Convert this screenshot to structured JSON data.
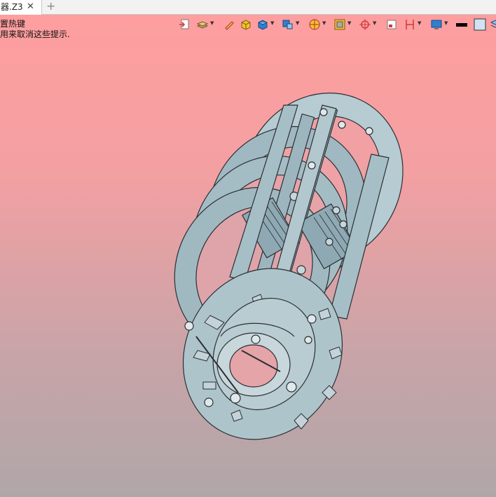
{
  "tab": {
    "title": "器.Z3",
    "close_glyph": "✕",
    "add_glyph": "+"
  },
  "hint": {
    "line1": "置热键",
    "line2": "用来取消这些提示."
  },
  "toolbar": {
    "icons": [
      "import-icon",
      "layers-icon",
      "pencil-icon",
      "box-face-icon",
      "solid-box-icon",
      "view-orient-icon",
      "render-mode-icon",
      "section-icon",
      "snap-icon",
      "frame-icon",
      "measure-icon",
      "display-icon",
      "line-color-swatch",
      "background-swatch",
      "extra-icon"
    ],
    "colors": {
      "accent_blue": "#2f7fd0",
      "accent_yellow": "#f4c22b",
      "accent_red": "#d23a3a"
    }
  },
  "viewport": {
    "background_top": "#ff9e9f",
    "background_bottom": "#b0a6a8",
    "model_color": "#a9c1c9",
    "model_edge": "#2b2f33"
  }
}
